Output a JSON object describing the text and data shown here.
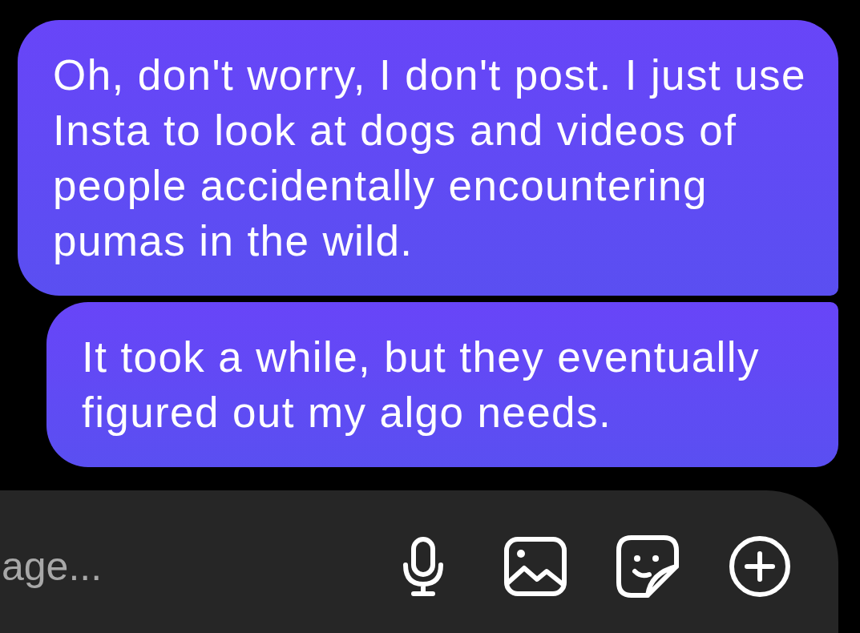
{
  "messages": [
    {
      "text": "Oh, don't worry, I don't post. I just use Insta to look at dogs and videos of people accidentally encountering pumas in the wild."
    },
    {
      "text": "It took a while, but they eventually figured out my algo needs."
    }
  ],
  "composer": {
    "placeholder": "age..."
  }
}
